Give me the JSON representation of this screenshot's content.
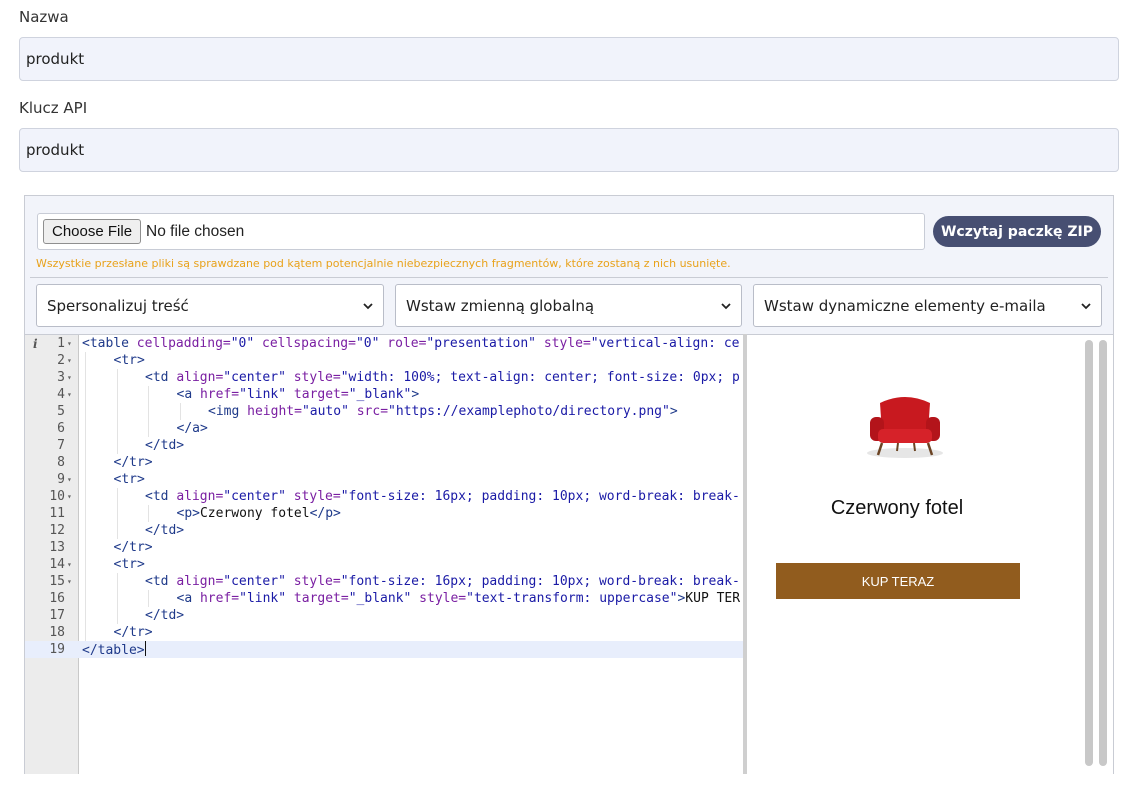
{
  "form": {
    "name_label": "Nazwa",
    "name_value": "produkt",
    "api_key_label": "Klucz API",
    "api_key_value": "produkt"
  },
  "upload": {
    "choose_file_label": "Choose File",
    "no_file_text": "No file chosen",
    "load_zip_button": "Wczytaj paczkę ZIP",
    "warning_text": "Wszystkie przesłane pliki są sprawdzane pod kątem potencjalnie niebezpiecznych fragmentów, które zostaną z nich usunięte.",
    "warning_color": "#e8a21b",
    "button_color": "#474f72"
  },
  "selects": {
    "personalize": "Spersonalizuj treść",
    "global_variable": "Wstaw zmienną globalną",
    "dynamic_elements": "Wstaw dynamiczne elementy e-maila"
  },
  "editor": {
    "info_icon_text": "i",
    "lines": [
      {
        "n": "1",
        "fold": true,
        "indent": 0,
        "html": "<span class='tag'>&lt;table</span> <span class='attr'>cellpadding=</span><span class='str'>\"0\"</span> <span class='attr'>cellspacing=</span><span class='str'>\"0\"</span> <span class='attr'>role=</span><span class='str'>\"presentation\"</span> <span class='attr'>style=</span><span class='str'>\"vertical-align: ce</span>"
      },
      {
        "n": "2",
        "fold": true,
        "indent": 1,
        "html": "<span class='tag'>&lt;tr&gt;</span>"
      },
      {
        "n": "3",
        "fold": true,
        "indent": 2,
        "html": "<span class='tag'>&lt;td</span> <span class='attr'>align=</span><span class='str'>\"center\"</span> <span class='attr'>style=</span><span class='str'>\"width: 100%; text-align: center; font-size: 0px; p</span>"
      },
      {
        "n": "4",
        "fold": true,
        "indent": 3,
        "html": "<span class='tag'>&lt;a</span> <span class='attr'>href=</span><span class='str'>\"link\"</span> <span class='attr'>target=</span><span class='str'>\"_blank\"</span><span class='tag'>&gt;</span>"
      },
      {
        "n": "5",
        "fold": false,
        "indent": 4,
        "html": "<span class='tag'>&lt;img</span> <span class='attr'>height=</span><span class='str'>\"auto\"</span> <span class='attr'>src=</span><span class='str'>\"https://examplephoto/directory.png\"</span><span class='tag'>&gt;</span>"
      },
      {
        "n": "6",
        "fold": false,
        "indent": 3,
        "html": "<span class='tag'>&lt;/a&gt;</span>"
      },
      {
        "n": "7",
        "fold": false,
        "indent": 2,
        "html": "<span class='tag'>&lt;/td&gt;</span>"
      },
      {
        "n": "8",
        "fold": false,
        "indent": 1,
        "html": "<span class='tag'>&lt;/tr&gt;</span>"
      },
      {
        "n": "9",
        "fold": true,
        "indent": 1,
        "html": "<span class='tag'>&lt;tr&gt;</span>"
      },
      {
        "n": "10",
        "fold": true,
        "indent": 2,
        "html": "<span class='tag'>&lt;td</span> <span class='attr'>align=</span><span class='str'>\"center\"</span> <span class='attr'>style=</span><span class='str'>\"font-size: 16px; padding: 10px; word-break: break-</span>"
      },
      {
        "n": "11",
        "fold": false,
        "indent": 3,
        "html": "<span class='tag'>&lt;p&gt;</span><span class='txt'>Czerwony fotel</span><span class='tag'>&lt;/p&gt;</span>"
      },
      {
        "n": "12",
        "fold": false,
        "indent": 2,
        "html": "<span class='tag'>&lt;/td&gt;</span>"
      },
      {
        "n": "13",
        "fold": false,
        "indent": 1,
        "html": "<span class='tag'>&lt;/tr&gt;</span>"
      },
      {
        "n": "14",
        "fold": true,
        "indent": 1,
        "html": "<span class='tag'>&lt;tr&gt;</span>"
      },
      {
        "n": "15",
        "fold": true,
        "indent": 2,
        "html": "<span class='tag'>&lt;td</span> <span class='attr'>align=</span><span class='str'>\"center\"</span> <span class='attr'>style=</span><span class='str'>\"font-size: 16px; padding: 10px; word-break: break-</span>"
      },
      {
        "n": "16",
        "fold": false,
        "indent": 3,
        "html": "<span class='tag'>&lt;a</span> <span class='attr'>href=</span><span class='str'>\"link\"</span> <span class='attr'>target=</span><span class='str'>\"_blank\"</span> <span class='attr'>style=</span><span class='str'>\"text-transform: uppercase\"</span><span class='tag'>&gt;</span><span class='txt'>KUP TER</span>"
      },
      {
        "n": "17",
        "fold": false,
        "indent": 2,
        "html": "<span class='tag'>&lt;/td&gt;</span>"
      },
      {
        "n": "18",
        "fold": false,
        "indent": 1,
        "html": "<span class='tag'>&lt;/tr&gt;</span>"
      },
      {
        "n": "19",
        "fold": false,
        "indent": 0,
        "active": true,
        "html": "<span class='tag'>&lt;/table&gt;</span><span class='cursor'></span>"
      }
    ]
  },
  "preview": {
    "image_icon": "red-armchair",
    "title": "Czerwony fotel",
    "button_label": "KUP TERAZ",
    "button_color": "#915c1e"
  }
}
